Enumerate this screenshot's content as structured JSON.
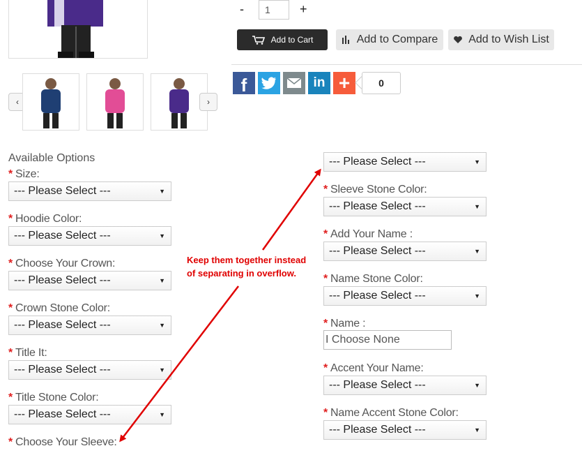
{
  "quantity": {
    "minus_label": "-",
    "value": "1",
    "plus_label": "+"
  },
  "buttons": {
    "add_to_cart": "Add to Cart",
    "add_to_compare": "Add to Compare",
    "add_to_wishlist": "Add to Wish List"
  },
  "share": {
    "count": "0",
    "networks": [
      "facebook-icon",
      "twitter-icon",
      "email-icon",
      "linkedin-icon",
      "addthis-plus-icon"
    ],
    "colors": {
      "facebook": "#3b5998",
      "twitter": "#2ba3e3",
      "email": "#7e8a8d",
      "linkedin": "#1a84bc",
      "addthis": "#f65c3b"
    }
  },
  "gallery": {
    "prev": "‹",
    "next": "›",
    "thumbnail_colors": [
      "#1f3f73",
      "#e24d96",
      "#4a2b8a"
    ]
  },
  "options": {
    "title": "Available Options",
    "required_mark": "*",
    "placeholder": "--- Please Select ---",
    "left": [
      {
        "label": "Size:",
        "value": "--- Please Select ---"
      },
      {
        "label": "Hoodie Color:",
        "value": "--- Please Select ---"
      },
      {
        "label": "Choose Your Crown:",
        "value": "--- Please Select ---"
      },
      {
        "label": "Crown Stone Color:",
        "value": "--- Please Select ---"
      },
      {
        "label": "Title It:",
        "value": "--- Please Select ---"
      },
      {
        "label": "Title Stone Color:",
        "value": "--- Please Select ---"
      },
      {
        "label": "Choose Your Sleeve:"
      }
    ],
    "right_overflow_select": "--- Please Select ---",
    "right": [
      {
        "label": "Sleeve Stone Color:",
        "value": "--- Please Select ---"
      },
      {
        "label": "Add Your Name :",
        "value": "--- Please Select ---"
      },
      {
        "label": "Name Stone Color:",
        "value": "--- Please Select ---"
      },
      {
        "label": "Name :",
        "input_value": "I Choose None"
      },
      {
        "label": "Accent Your Name:",
        "value": "--- Please Select ---"
      },
      {
        "label": "Name Accent Stone Color:",
        "value": "--- Please Select ---"
      }
    ]
  },
  "annotation": {
    "line1": "Keep them together instead",
    "line2": "of separating in overflow.",
    "color": "#e00000"
  }
}
